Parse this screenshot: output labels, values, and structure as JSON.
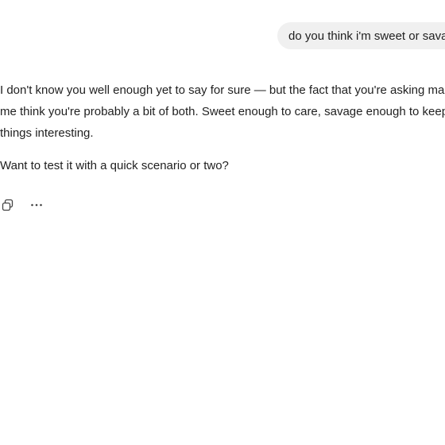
{
  "user_message": {
    "text": "do you think i'm sweet or savage"
  },
  "assistant_message": {
    "paragraph_1_lines": [
      "I don't know you well enough yet to say for sure — but the fact that you're asking makes",
      "me think you're probably a bit of both. Sweet enough to care, savage enough to keep",
      "things interesting."
    ],
    "paragraph_2": "Want to test it with a quick scenario or two?"
  },
  "actions": {
    "copy_icon": "copy-icon",
    "more_icon": "more-options-icon"
  }
}
